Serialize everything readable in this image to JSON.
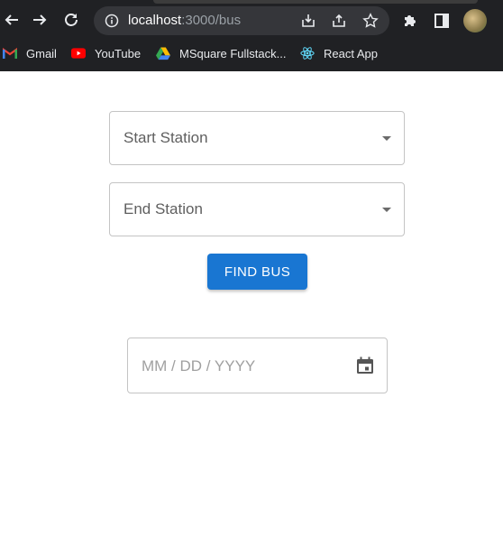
{
  "browser": {
    "url_host": "localhost",
    "url_path": ":3000/bus",
    "bookmarks": [
      {
        "label": "Gmail",
        "icon": "gmail-icon"
      },
      {
        "label": "YouTube",
        "icon": "youtube-icon"
      },
      {
        "label": "MSquare Fullstack...",
        "icon": "google-drive-icon"
      },
      {
        "label": "React App",
        "icon": "react-icon"
      }
    ]
  },
  "form": {
    "start_station_label": "Start Station",
    "end_station_label": "End Station",
    "find_button_label": "FIND BUS",
    "date_placeholder": "MM / DD / YYYY"
  },
  "colors": {
    "primary": "#1976d2",
    "chrome_dark": "#202124"
  }
}
